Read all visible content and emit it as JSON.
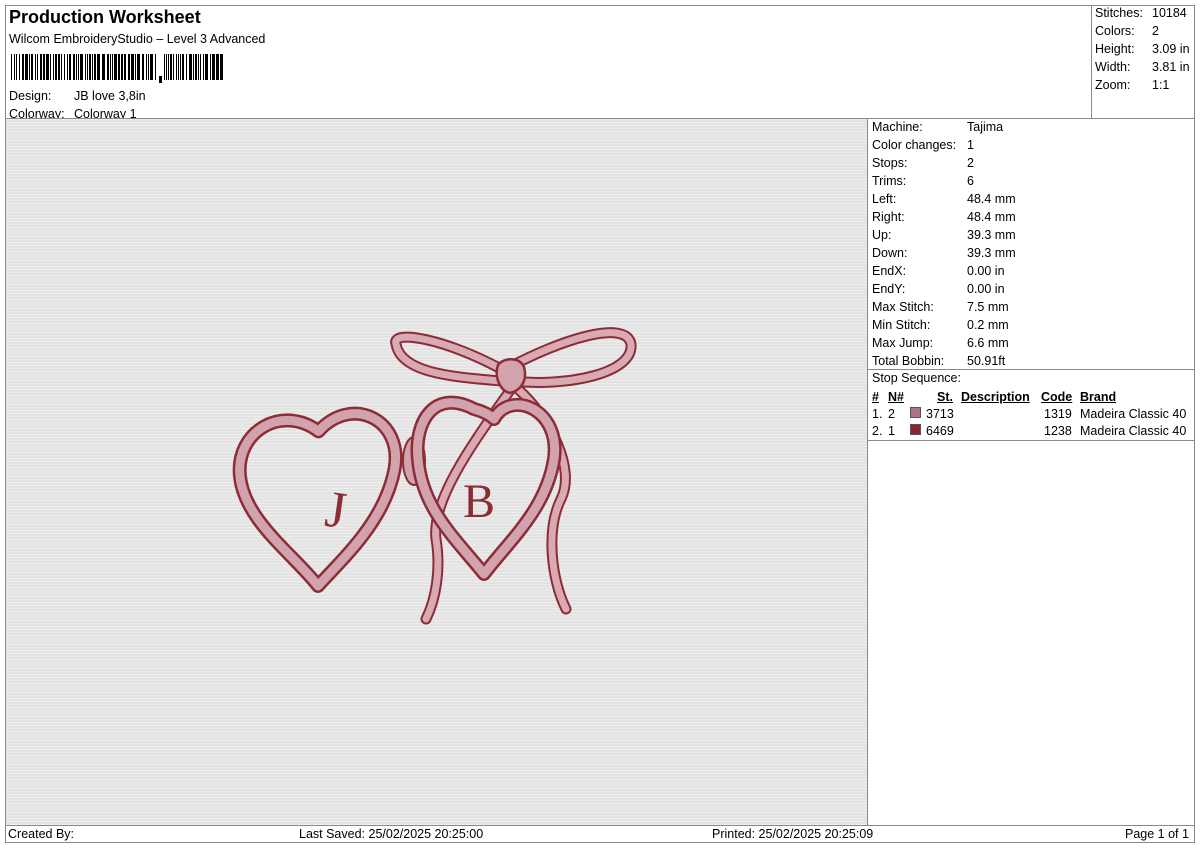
{
  "header": {
    "title": "Production Worksheet",
    "subtitle": "Wilcom EmbroideryStudio – Level 3 Advanced",
    "design_label": "Design:",
    "design_value": "JB love 3,8in",
    "colorway_label": "Colorway:",
    "colorway_value": "Colorway 1"
  },
  "summary": {
    "stitches_label": "Stitches:",
    "stitches_value": "10184",
    "colors_label": "Colors:",
    "colors_value": "2",
    "height_label": "Height:",
    "height_value": "3.09 in",
    "width_label": "Width:",
    "width_value": "3.81 in",
    "zoom_label": "Zoom:",
    "zoom_value": "1:1"
  },
  "details": [
    {
      "label": "Machine:",
      "value": "Tajima"
    },
    {
      "label": "Color changes:",
      "value": "1"
    },
    {
      "label": "Stops:",
      "value": "2"
    },
    {
      "label": "Trims:",
      "value": "6"
    },
    {
      "label": "Left:",
      "value": "48.4 mm"
    },
    {
      "label": "Right:",
      "value": "48.4 mm"
    },
    {
      "label": "Up:",
      "value": "39.3 mm"
    },
    {
      "label": "Down:",
      "value": "39.3 mm"
    },
    {
      "label": "EndX:",
      "value": "0.00 in"
    },
    {
      "label": "EndY:",
      "value": "0.00 in"
    },
    {
      "label": "Max Stitch:",
      "value": "7.5 mm"
    },
    {
      "label": "Min Stitch:",
      "value": "0.2 mm"
    },
    {
      "label": "Max Jump:",
      "value": "6.6 mm"
    },
    {
      "label": "Total Bobbin:",
      "value": "50.91ft"
    }
  ],
  "stop_sequence": {
    "title": "Stop Sequence:",
    "headers": {
      "idx": "#",
      "num": "N#",
      "st": "St.",
      "description": "Description",
      "code": "Code",
      "brand": "Brand"
    },
    "rows": [
      {
        "idx": "1.",
        "num": "2",
        "st": "3713",
        "code": "1319",
        "brand": "Madeira Classic 40",
        "color": "#b0708a"
      },
      {
        "idx": "2.",
        "num": "1",
        "st": "6469",
        "code": "1238",
        "brand": "Madeira Classic 40",
        "color": "#8c2431"
      }
    ]
  },
  "artwork": {
    "letter_left": "J",
    "letter_right": "B",
    "fill_color": "#d3a3ad",
    "outline_color": "#8c2c36"
  },
  "footer": {
    "created_by": "Created By:",
    "last_saved": "Last Saved: 25/02/2025 20:25:00",
    "printed": "Printed: 25/02/2025 20:25:09",
    "page": "Page 1 of 1"
  }
}
